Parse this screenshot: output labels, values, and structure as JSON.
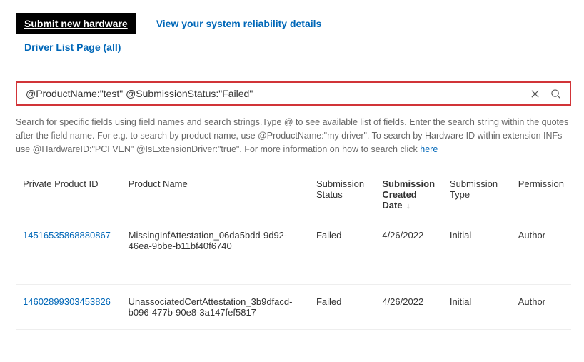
{
  "actions": {
    "submit_label": "Submit new hardware",
    "reliability_label": "View your system reliability details",
    "driver_list_label": "Driver List Page (all)"
  },
  "search": {
    "value": "@ProductName:\"test\" @SubmissionStatus:\"Failed\""
  },
  "help": {
    "line1": "Search for specific fields using field names and search strings.Type @ to see available list of fields. Enter the search string within the quotes after the field name. For e.g. to search by product name, use @ProductName:\"my driver\". To search by Hardware ID within extension INFs use @HardwareID:\"PCI VEN\" @IsExtensionDriver:\"true\". For more information on how to search click ",
    "link": "here"
  },
  "table": {
    "headers": {
      "id": "Private Product ID",
      "name": "Product Name",
      "status": "Submission Status",
      "date": "Submission Created Date",
      "type": "Submission Type",
      "permission": "Permission"
    },
    "rows": [
      {
        "id": "14516535868880867",
        "name": "MissingInfAttestation_06da5bdd-9d92-46ea-9bbe-b11bf40f6740",
        "status": "Failed",
        "date": "4/26/2022",
        "type": "Initial",
        "permission": "Author"
      },
      {
        "id": "14602899303453826",
        "name": "UnassociatedCertAttestation_3b9dfacd-b096-477b-90e8-3a147fef5817",
        "status": "Failed",
        "date": "4/26/2022",
        "type": "Initial",
        "permission": "Author"
      }
    ]
  }
}
